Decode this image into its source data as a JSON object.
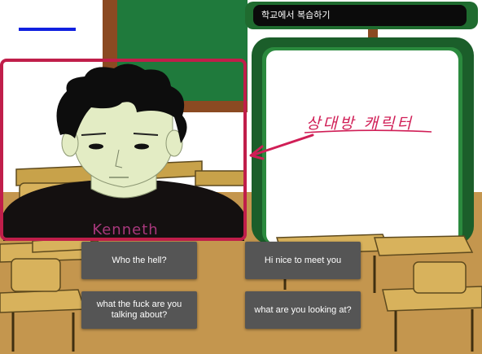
{
  "app": {
    "title": "학교에서 복습하기"
  },
  "character": {
    "shirt_name": "Kenneth"
  },
  "annotation": {
    "label": "상대방 캐릭터",
    "color": "#d01e56"
  },
  "choices": [
    {
      "label": "Who the hell?"
    },
    {
      "label": "Hi nice to meet you"
    },
    {
      "label": "what the fuck are you talking about?"
    },
    {
      "label": "what are you looking at?"
    }
  ],
  "colors": {
    "chalkboard": "#1f7a3c",
    "board_frame": "#8b4a22",
    "floor": "#c89a52",
    "button_bg": "#555555",
    "highlight_frame": "#c01e4a",
    "title_bg": "#0b0b0b",
    "title_border": "#1f6b2f"
  }
}
